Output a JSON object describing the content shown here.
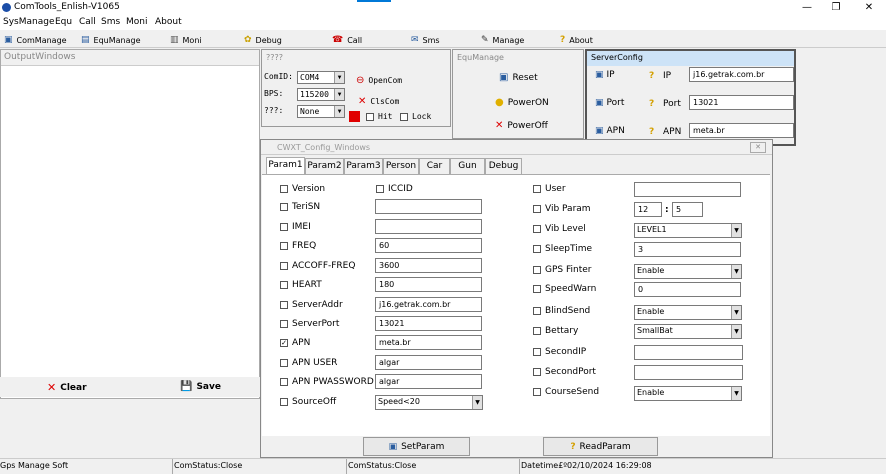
{
  "window": {
    "title": "ComTools_Enlish-V1065",
    "minimize": "—",
    "maximize": "❐",
    "close": "✕"
  },
  "menu": [
    "SysManage",
    "Equ",
    "Call",
    "Sms",
    "Moni",
    "About"
  ],
  "toolbar": [
    {
      "label": "ComManage",
      "icon": "com-manage-icon"
    },
    {
      "label": "EquManage",
      "icon": "equ-manage-icon"
    },
    {
      "label": "Moni",
      "icon": "moni-icon"
    },
    {
      "label": "Debug",
      "icon": "debug-icon"
    },
    {
      "label": "Call",
      "icon": "call-icon"
    },
    {
      "label": "Sms",
      "icon": "sms-icon"
    },
    {
      "label": "Manage",
      "icon": "manage-icon"
    },
    {
      "label": "About",
      "icon": "about-icon"
    }
  ],
  "output": {
    "title": "OutputWindows",
    "clear": "Clear",
    "save": "Save"
  },
  "com": {
    "title": "????",
    "comid_label": "ComID:",
    "comid_value": "COM4",
    "bps_label": "BPS:",
    "bps_value": "115200",
    "parity_label": "???:",
    "parity_value": "None",
    "open": "OpenCom",
    "close": "ClsCom",
    "hit": "Hit",
    "lock": "Lock"
  },
  "equ": {
    "title": "EquManage",
    "reset": "Reset",
    "poweron": "PowerON",
    "poweroff": "PowerOff"
  },
  "server": {
    "title": "ServerConfig",
    "rows": [
      {
        "btn": "IP",
        "label": "IP",
        "value": "j16.getrak.com.br"
      },
      {
        "btn": "Port",
        "label": "Port",
        "value": "13021"
      },
      {
        "btn": "APN",
        "label": "APN",
        "value": "meta.br"
      }
    ]
  },
  "config": {
    "title": "CWXT_Config_Windows",
    "close_glyph": "✕",
    "tabs": [
      "Param1",
      "Param2",
      "Param3",
      "Person",
      "Car",
      "Gun",
      "Debug"
    ],
    "iccid": "ICCID",
    "left": [
      {
        "label": "Version",
        "checked": false,
        "value": null
      },
      {
        "label": "TeriSN",
        "checked": false,
        "value": ""
      },
      {
        "label": "IMEI",
        "checked": false,
        "value": ""
      },
      {
        "label": "FREQ",
        "checked": false,
        "value": "60"
      },
      {
        "label": "ACCOFF-FREQ",
        "checked": false,
        "value": "3600"
      },
      {
        "label": "HEART",
        "checked": false,
        "value": "180"
      },
      {
        "label": "ServerAddr",
        "checked": false,
        "value": "j16.getrak.com.br"
      },
      {
        "label": "ServerPort",
        "checked": false,
        "value": "13021"
      },
      {
        "label": "APN",
        "checked": true,
        "value": "meta.br"
      },
      {
        "label": "APN USER",
        "checked": false,
        "value": "algar"
      },
      {
        "label": "APN PWASSWORD",
        "checked": false,
        "value": "algar"
      },
      {
        "label": "SourceOff",
        "checked": false,
        "value": "Speed<20",
        "combo": true
      }
    ],
    "right": [
      {
        "label": "User",
        "value": ""
      },
      {
        "label": "Vib Param",
        "value": "12",
        "value2": "5",
        "sep": ":"
      },
      {
        "label": "Vib Level",
        "value": "LEVEL1",
        "combo": true
      },
      {
        "label": "SleepTime",
        "value": "3"
      },
      {
        "label": "GPS Finter",
        "value": "Enable",
        "combo": true
      },
      {
        "label": "SpeedWarn",
        "value": "0"
      },
      {
        "label": "BlindSend",
        "value": "Enable",
        "combo": true
      },
      {
        "label": "Bettary",
        "value": "SmallBat",
        "combo": true
      },
      {
        "label": "SecondIP",
        "value": ""
      },
      {
        "label": "SecondPort",
        "value": ""
      },
      {
        "label": "CourseSend",
        "value": "Enable",
        "combo": true
      }
    ],
    "set": "SetParam",
    "read": "ReadParam"
  },
  "status": {
    "app": "Gps Manage Soft",
    "com1": "ComStatus:Close",
    "com2": "ComStatus:Close",
    "datetime": "Datetime£º02/10/2024 16:29:08"
  }
}
